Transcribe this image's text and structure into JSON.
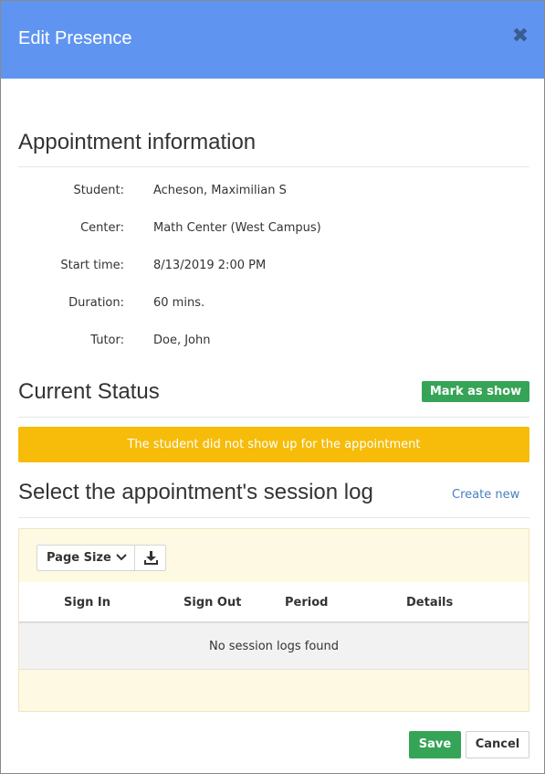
{
  "header": {
    "title": "Edit Presence",
    "close_icon": "close-icon"
  },
  "appointment": {
    "heading": "Appointment information",
    "fields": [
      {
        "label": "Student:",
        "value": "Acheson, Maximilian S"
      },
      {
        "label": "Center:",
        "value": "Math Center (West Campus)"
      },
      {
        "label": "Start time:",
        "value": "8/13/2019 2:00 PM"
      },
      {
        "label": "Duration:",
        "value": "60 mins."
      },
      {
        "label": "Tutor:",
        "value": "Doe, John"
      }
    ]
  },
  "status": {
    "heading": "Current Status",
    "mark_button": "Mark as show",
    "alert_text": "The student did not show up for the appointment",
    "alert_color": "#f6bc09"
  },
  "session_log": {
    "heading": "Select the appointment's session log",
    "create_link": "Create new",
    "page_size_label": "Page Size",
    "columns": [
      "Sign In",
      "Sign Out",
      "Period",
      "Details"
    ],
    "empty_text": "No session logs found"
  },
  "footer": {
    "save_label": "Save",
    "cancel_label": "Cancel"
  },
  "colors": {
    "header": "#5f95f0",
    "primary": "#35a456",
    "link": "#4a7fc0"
  }
}
